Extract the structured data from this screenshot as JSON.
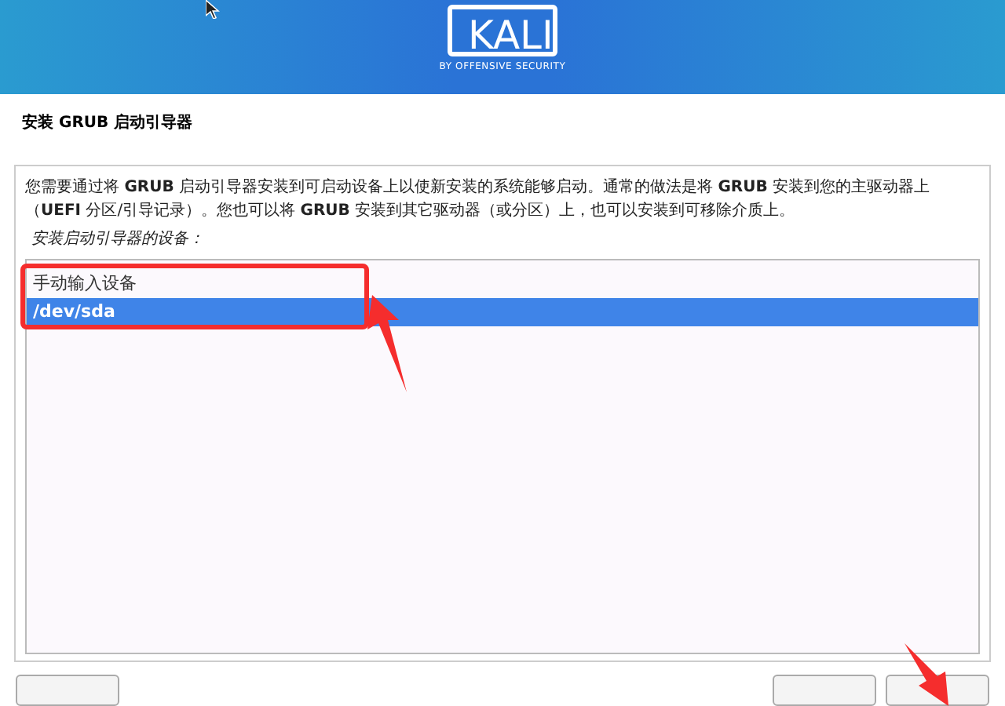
{
  "header": {
    "logo": "KALI",
    "tagline": "BY OFFENSIVE SECURITY"
  },
  "title": "安装 GRUB 启动引导器",
  "description": "您需要通过将 **GRUB** 启动引导器安装到可启动设备上以使新安装的系统能够启动。通常的做法是将 **GRUB** 安装到您的主驱动器上（**UEFI** 分区/引导记录）。您也可以将 **GRUB** 安装到其它驱动器（或分区）上，也可以安装到可移除介质上。",
  "prompt": "安装启动引导器的设备：",
  "devices": [
    {
      "label": "手动输入设备",
      "selected": false
    },
    {
      "label": "/dev/sda",
      "selected": true
    }
  ]
}
